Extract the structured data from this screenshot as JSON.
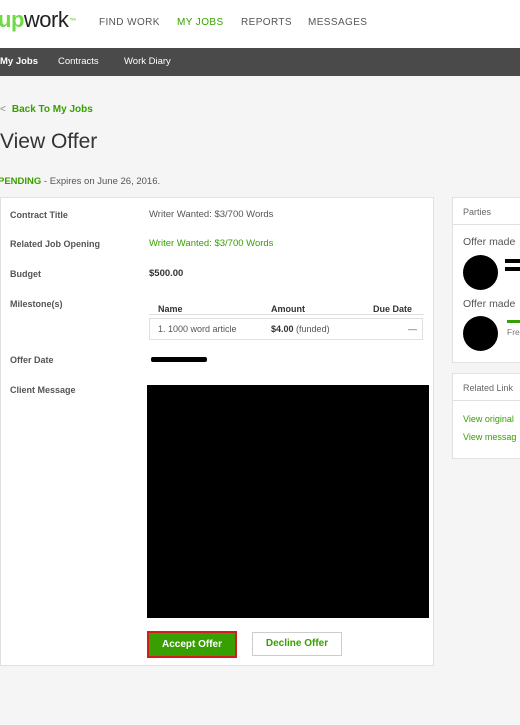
{
  "brand": {
    "logo_up": "up",
    "logo_work": "work",
    "logo_tm": "™"
  },
  "topnav": {
    "find_work": "FIND WORK",
    "my_jobs": "MY JOBS",
    "reports": "REPORTS",
    "messages": "MESSAGES"
  },
  "subnav": {
    "my_jobs": "My Jobs",
    "contracts": "Contracts",
    "work_diary": "Work Diary"
  },
  "page": {
    "back_link": "Back To My Jobs",
    "title": "View Offer",
    "status_label": "PENDING",
    "status_detail": " - Expires on June 26, 2016."
  },
  "offer": {
    "contract_title_label": "Contract Title",
    "contract_title_value": "Writer Wanted: $3/700 Words",
    "related_job_label": "Related Job Opening",
    "related_job_value": "Writer Wanted: $3/700 Words",
    "budget_label": "Budget",
    "budget_value": "$500.00",
    "milestones_label": "Milestone(s)",
    "offer_date_label": "Offer Date",
    "client_message_label": "Client Message"
  },
  "milestones": {
    "headers": {
      "name": "Name",
      "amount": "Amount",
      "due_date": "Due Date"
    },
    "rows": [
      {
        "name": "1. 1000 word article",
        "amount": "$4.00",
        "amount_note": "(funded)",
        "due": "—"
      }
    ]
  },
  "actions": {
    "accept": "Accept Offer",
    "decline": "Decline Offer"
  },
  "sidebar": {
    "parties_heading": "Parties",
    "offer_made_1": "Offer made",
    "offer_made_2": "Offer made",
    "party2_role": "Fre",
    "related_links_heading": "Related Link",
    "link_1": "View original",
    "link_2": "View messag"
  },
  "colors": {
    "accent": "#37a000",
    "logo": "#6fda44",
    "subnav_bg": "#4a4a4a",
    "highlight": "#d31c1c"
  }
}
